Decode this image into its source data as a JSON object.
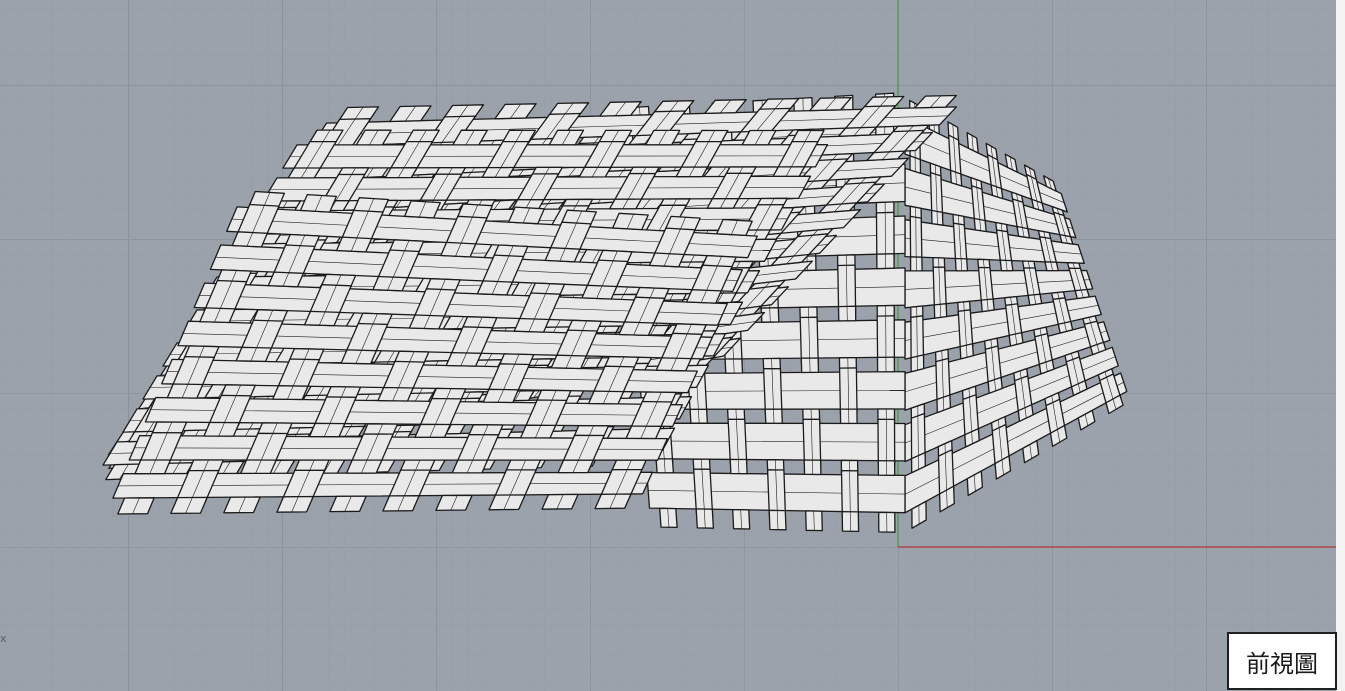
{
  "viewport": {
    "name": "前視圖",
    "background": "#9ba2ab",
    "grid_minor": "#969da6",
    "grid_major": "#838b94",
    "x_axis_color": "#b5383a",
    "z_axis_color": "#3fa33a",
    "world_axis_marker": "x",
    "model_fill": "#e9e9e9",
    "model_stroke": "#1b1b1b"
  }
}
